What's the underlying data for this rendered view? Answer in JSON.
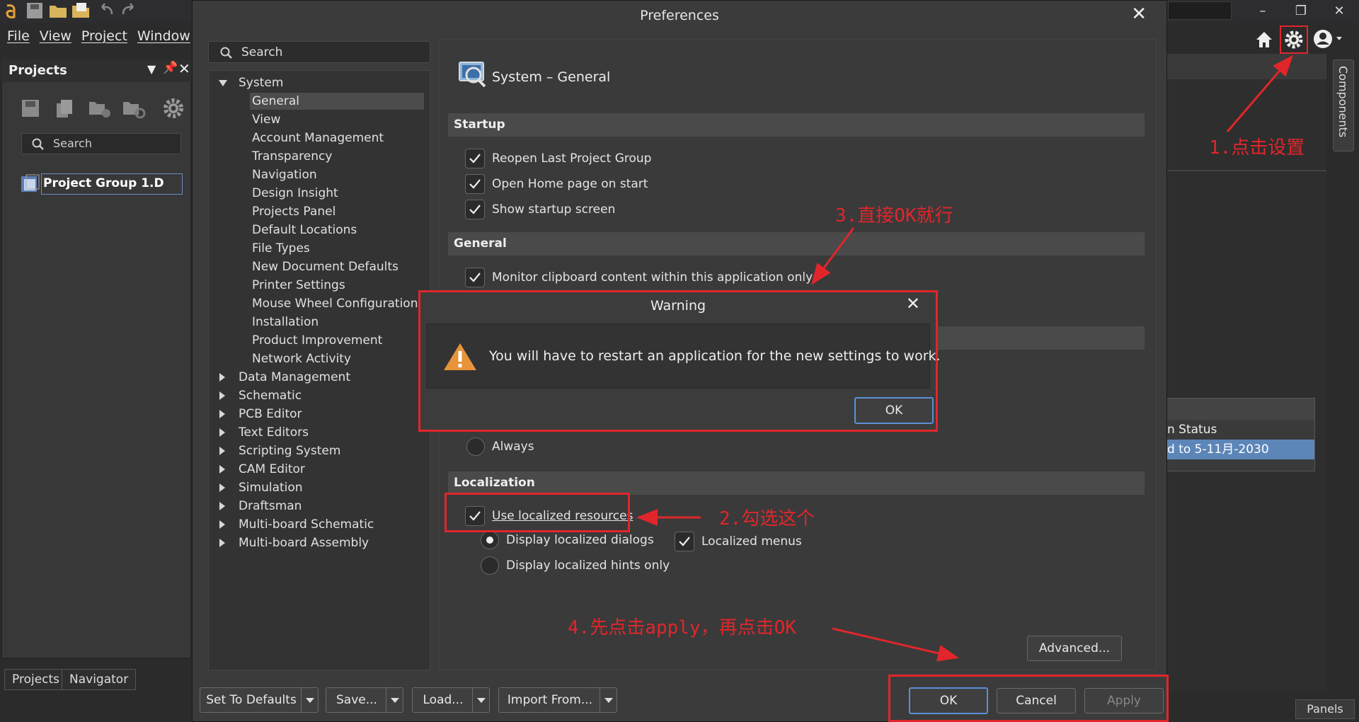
{
  "app": {
    "menu": [
      "File",
      "View",
      "Project",
      "Window"
    ],
    "projects_panel": {
      "title": "Projects",
      "search_placeholder": "Search",
      "project_item": "Project Group 1.D",
      "tabs": [
        "Projects",
        "Navigator"
      ]
    },
    "components_tab": "Components",
    "status_table": {
      "header": "n Status",
      "row": "d to 5-11月-2030"
    },
    "panels_button": "Panels"
  },
  "preferences": {
    "title": "Preferences",
    "search_placeholder": "Search",
    "tree": {
      "system": "System",
      "system_children": [
        "General",
        "View",
        "Account Management",
        "Transparency",
        "Navigation",
        "Design Insight",
        "Projects Panel",
        "Default Locations",
        "File Types",
        "New Document Defaults",
        "Printer Settings",
        "Mouse Wheel Configuration",
        "Installation",
        "Product Improvement",
        "Network Activity"
      ],
      "selected": "General",
      "groups": [
        "Data Management",
        "Schematic",
        "PCB Editor",
        "Text Editors",
        "Scripting System",
        "CAM Editor",
        "Simulation",
        "Draftsman",
        "Multi-board Schematic",
        "Multi-board Assembly"
      ]
    },
    "page_title": "System – General",
    "sections": {
      "startup": "Startup",
      "general": "General",
      "localization": "Localization"
    },
    "startup_options": [
      {
        "label": "Reopen Last Project Group",
        "checked": true
      },
      {
        "label": "Open Home page on start",
        "checked": true
      },
      {
        "label": "Show startup screen",
        "checked": true
      }
    ],
    "general_options": [
      {
        "label": "Monitor clipboard content within this application only",
        "checked": true
      }
    ],
    "always_radio": "Always",
    "localization": {
      "use_localized": {
        "label": "Use localized resources",
        "checked": true
      },
      "display_dialogs": {
        "label": "Display localized dialogs",
        "selected": true
      },
      "display_hints": {
        "label": "Display localized hints only",
        "selected": false
      },
      "localized_menus": {
        "label": "Localized menus",
        "checked": true
      }
    },
    "advanced_button": "Advanced...",
    "bottom_buttons": {
      "set_defaults": "Set To Defaults",
      "save": "Save...",
      "load": "Load...",
      "import": "Import From...",
      "ok": "OK",
      "cancel": "Cancel",
      "apply": "Apply"
    }
  },
  "warning": {
    "title": "Warning",
    "message": "You will have to restart an application for the new settings to work.",
    "ok": "OK"
  },
  "annotations": {
    "step1": "1.点击设置",
    "step2": "2.勾选这个",
    "step3": "3.直接OK就行",
    "step4": "4.先点击apply，再点击OK",
    "color": "#e0262b"
  }
}
